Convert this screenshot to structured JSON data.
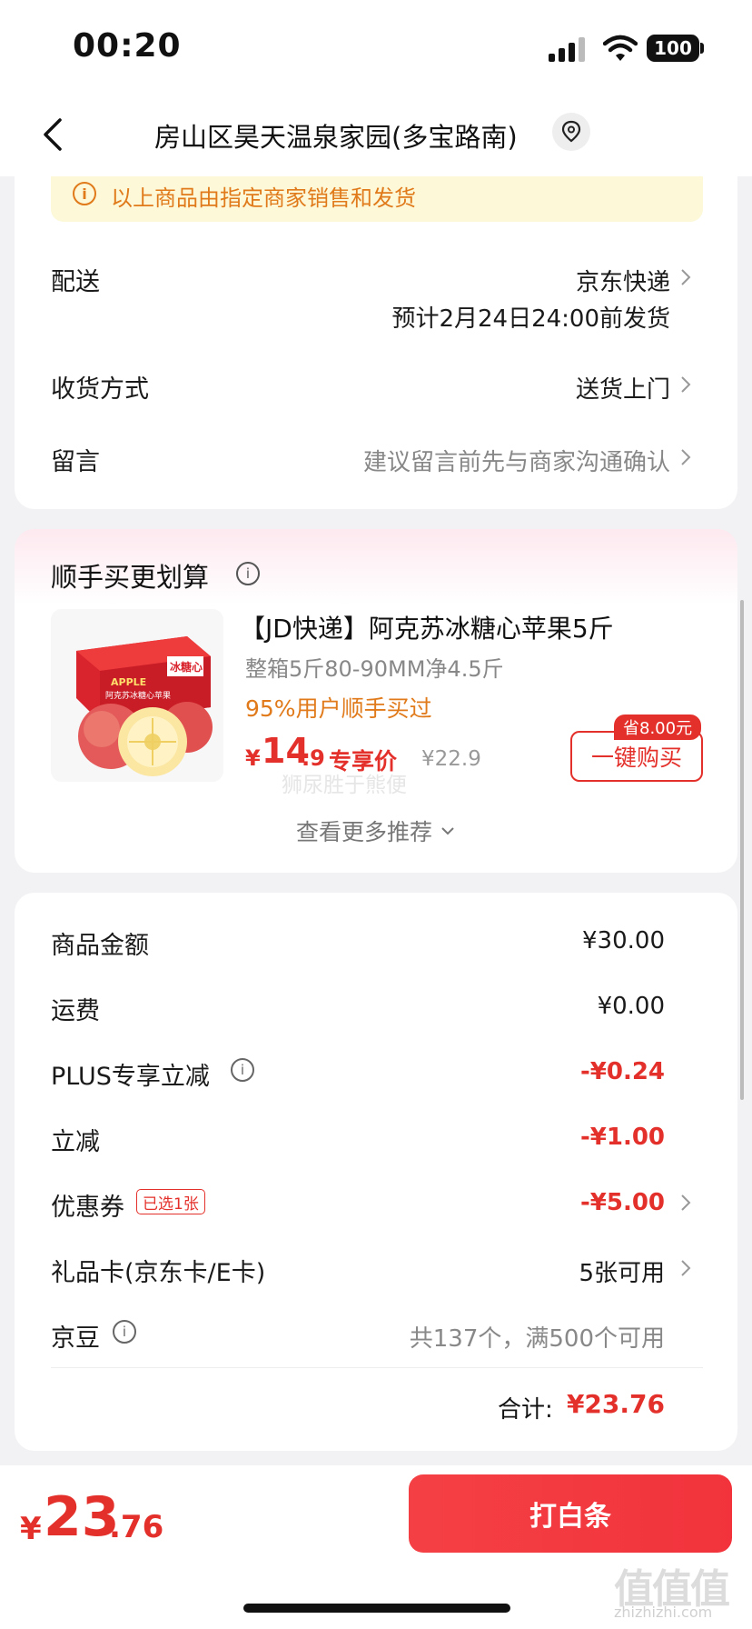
{
  "status_bar": {
    "time": "00:20",
    "battery": "100"
  },
  "header": {
    "title": "房山区昊天温泉家园(多宝路南)",
    "back_icon": "chevron-left-icon",
    "location_icon": "location-pin-icon"
  },
  "notice": {
    "text": "以上商品由指定商家销售和发货",
    "icon": "info-icon",
    "color": "#e07a1a"
  },
  "order_rows": {
    "delivery": {
      "label": "配送",
      "value": "京东快递",
      "sub": "预计2月24日24:00前发货"
    },
    "receive": {
      "label": "收货方式",
      "value": "送货上门"
    },
    "message": {
      "label": "留言",
      "placeholder": "建议留言前先与商家沟通确认"
    }
  },
  "recommend": {
    "title": "顺手买更划算",
    "product": {
      "title": "【JD快递】阿克苏冰糖心苹果5斤",
      "spec": "整箱5斤80-90MM净4.5斤",
      "social": "95%用户顺手买过",
      "price_currency": "¥",
      "price_int": "14",
      "price_dec": ".9",
      "price_tag": "专享价",
      "orig_price": "¥22.9",
      "save_badge": "省8.00元",
      "buy_label": "一键购买",
      "image_text_1": "APPLE",
      "image_text_2": "阿克苏冰糖心苹果",
      "image_text_3": "冰糖心"
    },
    "watermark": "狮尿胜于熊便",
    "more_label": "查看更多推荐"
  },
  "price_rows": {
    "goods": {
      "label": "商品金额",
      "value": "¥30.00"
    },
    "shipping": {
      "label": "运费",
      "value": "¥0.00"
    },
    "plus": {
      "label": "PLUS专享立减",
      "value": "-¥0.24"
    },
    "discount": {
      "label": "立减",
      "value": "-¥1.00"
    },
    "coupon": {
      "label": "优惠券",
      "badge": "已选1张",
      "value": "-¥5.00"
    },
    "giftcard": {
      "label": "礼品卡(京东卡/E卡)",
      "value": "5张可用"
    },
    "jingdou": {
      "label": "京豆",
      "value": "共137个，满500个可用"
    },
    "total": {
      "label": "合计:",
      "value": "¥23.76"
    }
  },
  "bottom_bar": {
    "currency": "¥",
    "amount_int": "23",
    "amount_dec": ".76",
    "pay_label": "打白条",
    "corner_mark": "值值值",
    "corner_url": "zhizhizhi.com"
  },
  "colors": {
    "accent_red": "#e4302b",
    "notice_orange": "#e07a1a",
    "notice_bg": "#fcf8d8"
  }
}
